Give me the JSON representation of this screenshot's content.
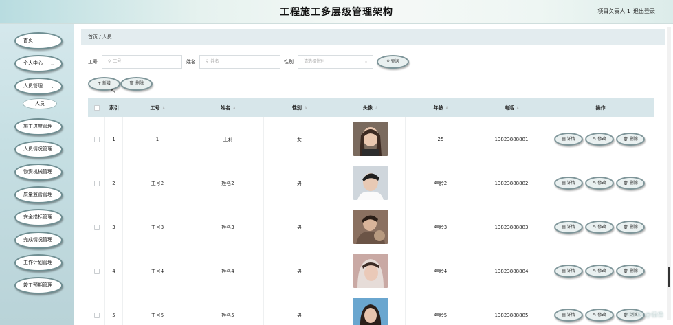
{
  "header": {
    "title": "工程施工多层级管理架构",
    "user": "项目负责人 1",
    "logout": "退出登录"
  },
  "sidebar": {
    "items": [
      {
        "label": "首页",
        "chevron": ""
      },
      {
        "label": "个人中心",
        "chevron": "⌄"
      },
      {
        "label": "人员管理",
        "chevron": "⌄"
      },
      {
        "label": "施工进度管理",
        "chevron": ""
      },
      {
        "label": "人员情况管理",
        "chevron": ""
      },
      {
        "label": "物资机械管理",
        "chevron": ""
      },
      {
        "label": "质量监管管理",
        "chevron": ""
      },
      {
        "label": "安全措标管理",
        "chevron": ""
      },
      {
        "label": "完成情况管理",
        "chevron": ""
      },
      {
        "label": "工作计划管理",
        "chevron": ""
      },
      {
        "label": "竣工预期管理",
        "chevron": ""
      }
    ],
    "sub_item": "人员"
  },
  "breadcrumb": "首页 / 人员",
  "filters": {
    "gonghao_label": "工号",
    "gonghao_placeholder": "工号",
    "name_label": "姓名",
    "name_placeholder": "姓名",
    "gender_label": "性别",
    "gender_placeholder": "请选择性别",
    "search_button": "查询"
  },
  "actions": {
    "add_button": "新增",
    "delete_button": "删除"
  },
  "table": {
    "columns": [
      "索引",
      "工号",
      "姓名",
      "性别",
      "头像",
      "年龄",
      "电话",
      "操作"
    ],
    "rows": [
      {
        "index": "1",
        "gonghao": "1",
        "name": "王莉",
        "gender": "女",
        "age": "25",
        "phone": "13823888881"
      },
      {
        "index": "2",
        "gonghao": "工号2",
        "name": "姓名2",
        "gender": "男",
        "age": "年龄2",
        "phone": "13823888882"
      },
      {
        "index": "3",
        "gonghao": "工号3",
        "name": "姓名3",
        "gender": "男",
        "age": "年龄3",
        "phone": "13823888883"
      },
      {
        "index": "4",
        "gonghao": "工号4",
        "name": "姓名4",
        "gender": "男",
        "age": "年龄4",
        "phone": "13823888884"
      },
      {
        "index": "5",
        "gonghao": "工号5",
        "name": "姓名5",
        "gender": "男",
        "age": "年龄5",
        "phone": "13823888885"
      }
    ],
    "row_actions": {
      "detail": "详情",
      "edit": "修改",
      "delete": "删除"
    }
  },
  "watermark": "CSDN @佳倫",
  "colors": {
    "sidebar_bg": "#c6dfe3",
    "header_row_bg": "#d7e6ea",
    "breadcrumb_bg": "#e3ecef",
    "pill_border": "#7e9599"
  }
}
